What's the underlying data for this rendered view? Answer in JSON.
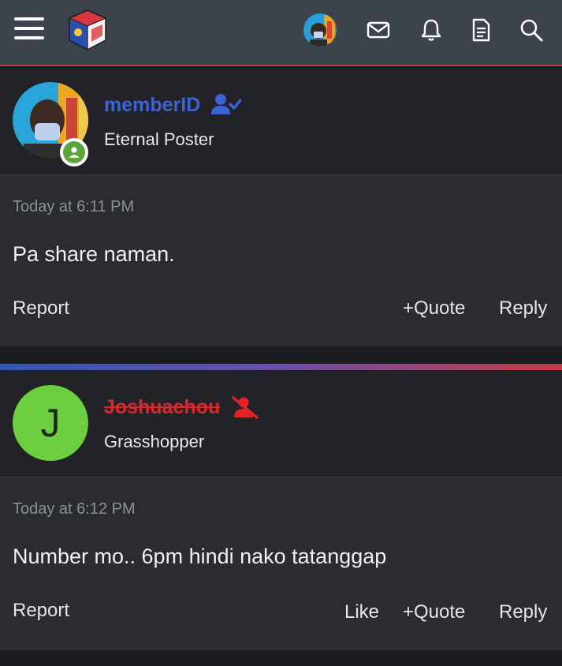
{
  "header": {
    "menu_icon": "hamburger-icon",
    "logo": "site-logo-cube",
    "icons": [
      "envelope-icon",
      "bell-icon",
      "document-icon",
      "search-icon"
    ]
  },
  "posts": [
    {
      "username": "memberID",
      "username_color": "#3d62d4",
      "badge_icon": "verified-user-icon",
      "user_title": "Eternal Poster",
      "timestamp": "Today at 6:11 PM",
      "message": "Pa share naman.",
      "actions": {
        "report": "Report",
        "quote": "Quote",
        "reply": "Reply"
      }
    },
    {
      "username": "Joshuachou",
      "username_color": "#e0242a",
      "badge_icon": "banned-user-icon",
      "avatar_letter": "J",
      "avatar_color": "#6bcf3f",
      "user_title": "Grasshopper",
      "timestamp": "Today at 6:12 PM",
      "message": "Number mo.. 6pm hindi nako tatanggap",
      "actions": {
        "report": "Report",
        "like": "Like",
        "quote": "Quote",
        "reply": "Reply"
      }
    }
  ]
}
